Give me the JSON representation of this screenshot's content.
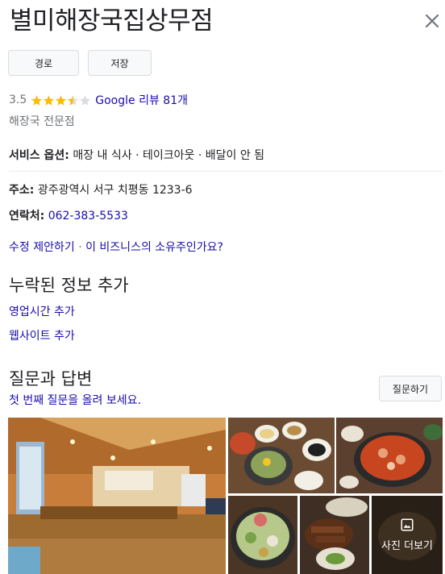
{
  "place": {
    "name": "별미해장국집상무점",
    "rating": "3.5",
    "stars": 3.5,
    "reviews_link": "Google 리뷰 81개",
    "category": "해장국 전문점"
  },
  "actions": {
    "directions": "경로",
    "save": "저장"
  },
  "details": {
    "service_label": "서비스 옵션:",
    "service_value": "매장 내 식사 · 테이크아웃 · 배달이 안 됨",
    "address_label": "주소:",
    "address_value": "광주광역시 서구 치평동 1233-6",
    "phone_label": "연락처:",
    "phone_value": "062-383-5533"
  },
  "suggest": {
    "edit": "수정 제안하기",
    "separator": "·",
    "owner": "이 비즈니스의 소유주인가요?"
  },
  "missing_info": {
    "heading": "누락된 정보 추가",
    "hours": "영업시간 추가",
    "website": "웹사이트 추가"
  },
  "qa": {
    "heading": "질문과 답변",
    "prompt": "첫 번째 질문을 올려 보세요.",
    "ask_button": "질문하기"
  },
  "photos": {
    "more_label": "사진 더보기"
  },
  "colors": {
    "link": "#1a0dab",
    "star": "#fbbc04",
    "muted": "#70757a"
  }
}
